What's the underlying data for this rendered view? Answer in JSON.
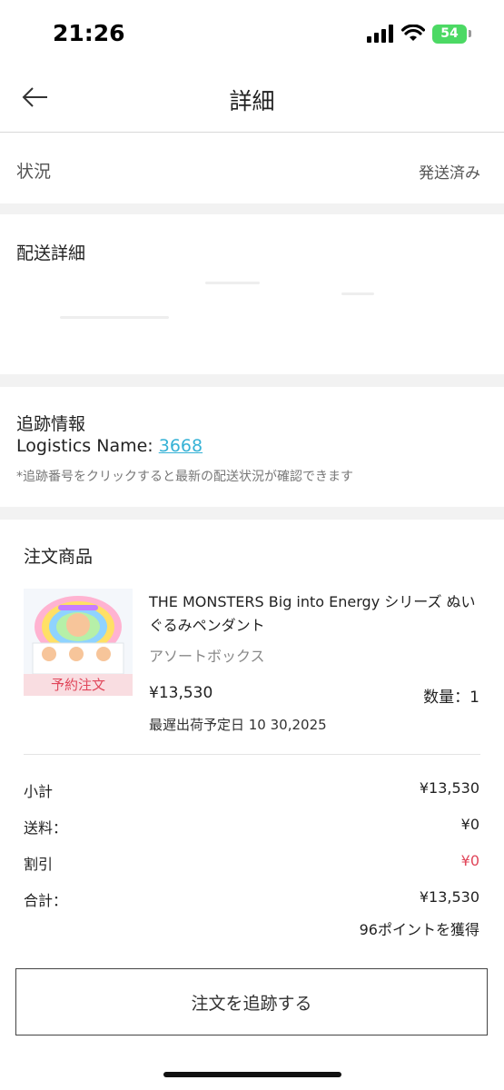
{
  "status_bar": {
    "time": "21:26",
    "battery": "54"
  },
  "header": {
    "title": "詳細",
    "back_icon": "arrow-left-icon"
  },
  "status_row": {
    "label": "状況",
    "value": "発送済み"
  },
  "shipping": {
    "label": "配送詳細"
  },
  "tracking": {
    "title": "追跡情報",
    "logistics_label": "Logistics Name: ",
    "tracking_number": "3668",
    "note": "*追跡番号をクリックすると最新の配送状況が確認できます"
  },
  "order": {
    "title": "注文商品",
    "product": {
      "badge": "予約注文",
      "name": "THE MONSTERS Big into Energy シリーズ ぬいぐるみペンダント",
      "variant": "アソートボックス",
      "price": "¥13,530",
      "quantity": "数量：1",
      "ship_date": "最遅出荷予定日 10 30,2025"
    },
    "summary": {
      "subtotal_label": "小計",
      "subtotal_value": "¥13,530",
      "shipping_label": "送料：",
      "shipping_value": "¥0",
      "discount_label": "割引",
      "discount_value": "¥0",
      "total_label": "合計：",
      "total_value": "¥13,530",
      "points": "96ポイントを獲得"
    }
  },
  "button": {
    "track_label": "注文を追跡する"
  },
  "colors": {
    "link": "#36b2d6",
    "discount": "#e0465a",
    "battery": "#4cd964",
    "section_gap": "#f2f2f2"
  }
}
